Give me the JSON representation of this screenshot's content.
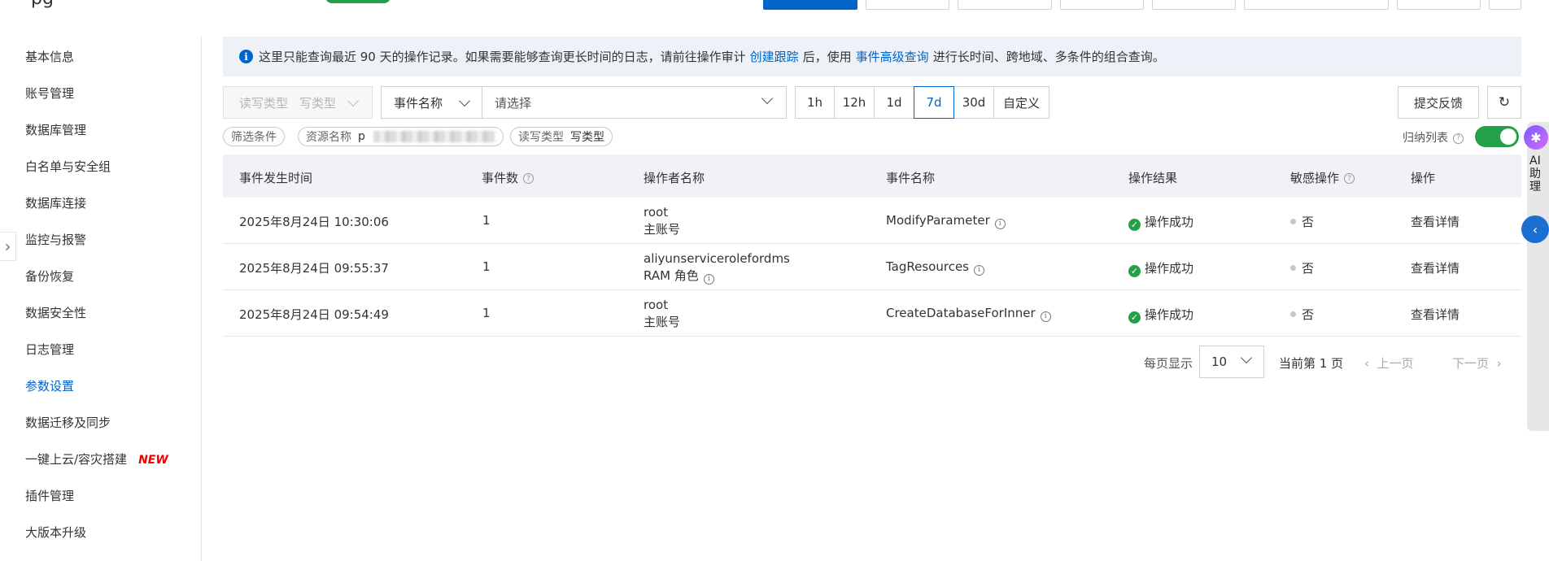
{
  "top": {
    "logo_fragment": "pg"
  },
  "sidebar": {
    "items": [
      {
        "label": "基本信息"
      },
      {
        "label": "账号管理"
      },
      {
        "label": "数据库管理"
      },
      {
        "label": "白名单与安全组"
      },
      {
        "label": "数据库连接"
      },
      {
        "label": "监控与报警"
      },
      {
        "label": "备份恢复"
      },
      {
        "label": "数据安全性"
      },
      {
        "label": "日志管理"
      },
      {
        "label": "参数设置"
      },
      {
        "label": "数据迁移及同步"
      },
      {
        "label": "一键上云/容灾搭建",
        "badge": "NEW"
      },
      {
        "label": "插件管理"
      },
      {
        "label": "大版本升级"
      }
    ],
    "active_index": 9
  },
  "notice": {
    "part1": "这里只能查询最近 90 天的操作记录。如果需要能够查询更长时间的日志，请前往操作审计",
    "link1": "创建跟踪",
    "part2": "后，使用",
    "link2": "事件高级查询",
    "part3": "进行长时间、跨地域、多条件的组合查询。"
  },
  "filters": {
    "rw_type_label": "读写类型",
    "rw_type_value": "写类型",
    "event_field": "事件名称",
    "event_placeholder": "请选择",
    "ranges": [
      "1h",
      "12h",
      "1d",
      "7d",
      "30d",
      "自定义"
    ],
    "active_range": "7d",
    "feedback": "提交反馈"
  },
  "tags": {
    "filter_label": "筛选条件",
    "resource_label": "资源名称",
    "resource_value_prefix": "p",
    "rw_label": "读写类型",
    "rw_value": "写类型"
  },
  "toggle": {
    "label": "归纳列表",
    "on": true
  },
  "table": {
    "headers": [
      "事件发生时间",
      "事件数",
      "操作者名称",
      "事件名称",
      "操作结果",
      "敏感操作",
      "操作"
    ],
    "rows": [
      {
        "time": "2025年8月24日 10:30:06",
        "count": "1",
        "operator": "root",
        "operator_type": "主账号",
        "operator_link": false,
        "event": "ModifyParameter",
        "result": "操作成功",
        "sensitive": "否",
        "action": "查看详情"
      },
      {
        "time": "2025年8月24日 09:55:37",
        "count": "1",
        "operator": "aliyunservicerolefordms",
        "operator_type": "RAM 角色",
        "operator_link": true,
        "event": "TagResources",
        "result": "操作成功",
        "sensitive": "否",
        "action": "查看详情"
      },
      {
        "time": "2025年8月24日 09:54:49",
        "count": "1",
        "operator": "root",
        "operator_type": "主账号",
        "operator_link": false,
        "event": "CreateDatabaseForInner",
        "result": "操作成功",
        "sensitive": "否",
        "action": "查看详情"
      }
    ]
  },
  "pagination": {
    "per_page_label": "每页显示",
    "per_page": "10",
    "current": "当前第 1 页",
    "prev": "上一页",
    "next": "下一页"
  },
  "assistant": {
    "label": "AI助理"
  },
  "colors": {
    "primary": "#0064c8",
    "success": "#23a048",
    "new_badge": "#e00000"
  }
}
